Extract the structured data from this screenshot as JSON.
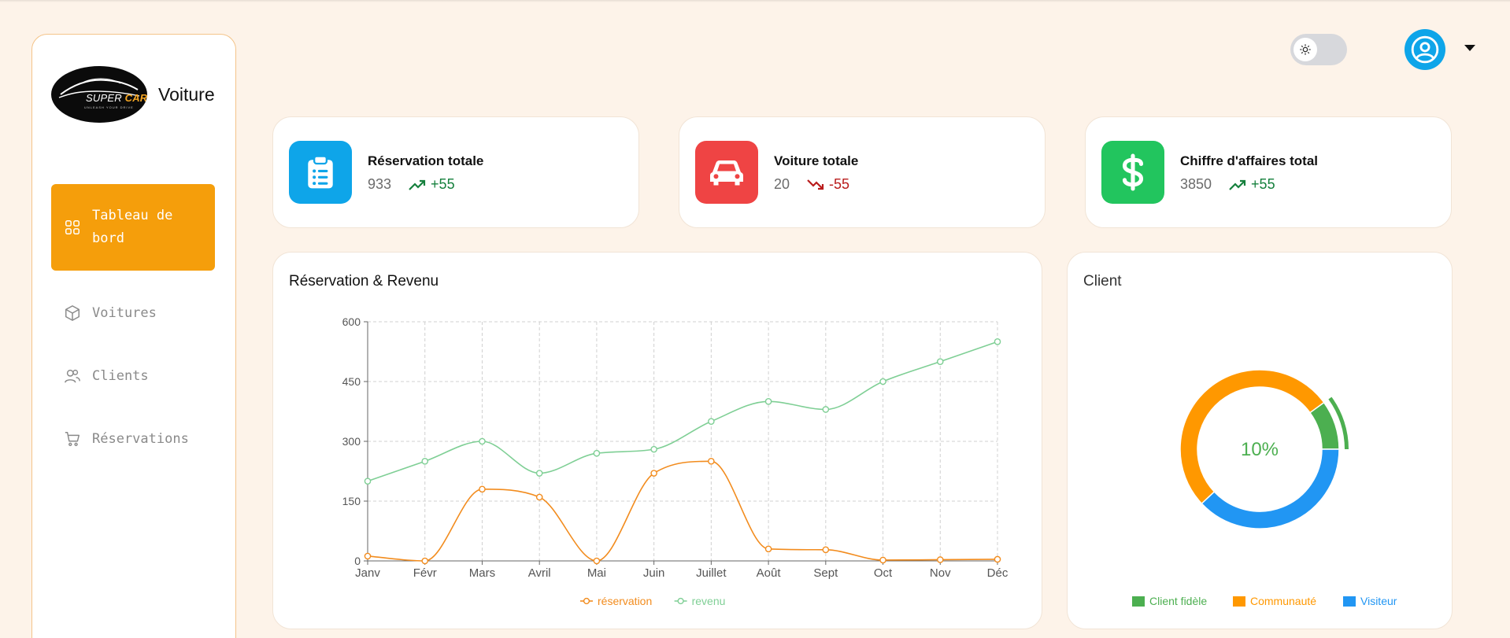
{
  "brand": {
    "name": "Voiture",
    "logo_word1": "SUPER",
    "logo_word2": "CAR",
    "logo_tagline": "UNLEASH YOUR DRIVE"
  },
  "nav": [
    {
      "label": "Tableau de bord",
      "icon": "grid-icon",
      "active": true
    },
    {
      "label": "Voitures",
      "icon": "cube-icon",
      "active": false
    },
    {
      "label": "Clients",
      "icon": "users-icon",
      "active": false
    },
    {
      "label": "Réservations",
      "icon": "cart-icon",
      "active": false
    }
  ],
  "topbar": {
    "theme_toggle_icon": "sun-icon",
    "avatar_icon": "user-circle-icon",
    "menu_icon": "caret-down-icon"
  },
  "stats": [
    {
      "title": "Réservation totale",
      "value": "933",
      "delta": "+55",
      "trend": "up",
      "icon": "clipboard-list-icon",
      "color": "#0ea5e9"
    },
    {
      "title": "Voiture totale",
      "value": "20",
      "delta": "-55",
      "trend": "down",
      "icon": "car-icon",
      "color": "#ef4444"
    },
    {
      "title": "Chiffre d'affaires total",
      "value": "3850",
      "delta": "+55",
      "trend": "up",
      "icon": "dollar-icon",
      "color": "#22c55e"
    }
  ],
  "line_card": {
    "title": "Réservation & Revenu"
  },
  "client_card": {
    "title": "Client"
  },
  "chart_data": [
    {
      "type": "line",
      "title": "Réservation & Revenu",
      "categories": [
        "Janv",
        "Févr",
        "Mars",
        "Avril",
        "Mai",
        "Juin",
        "Juillet",
        "Août",
        "Sept",
        "Oct",
        "Nov",
        "Déc"
      ],
      "ylim": [
        0,
        600
      ],
      "yticks": [
        0,
        150,
        300,
        450,
        600
      ],
      "grid": true,
      "legend": "bottom",
      "series": [
        {
          "name": "réservation",
          "color": "#f28c1e",
          "values": [
            12,
            0,
            180,
            160,
            0,
            220,
            250,
            30,
            28,
            2,
            3,
            4
          ]
        },
        {
          "name": "revenu",
          "color": "#7fcf95",
          "values": [
            200,
            250,
            300,
            220,
            270,
            280,
            350,
            400,
            380,
            450,
            500,
            550
          ]
        }
      ]
    },
    {
      "type": "pie",
      "title": "Client",
      "center_label": "10%",
      "legend": "bottom",
      "slices": [
        {
          "name": "Client fidèle",
          "value": 10,
          "color": "#4caf50"
        },
        {
          "name": "Communauté",
          "value": 52,
          "color": "#ff9800"
        },
        {
          "name": "Visiteur",
          "value": 38,
          "color": "#2196f3"
        }
      ]
    }
  ]
}
